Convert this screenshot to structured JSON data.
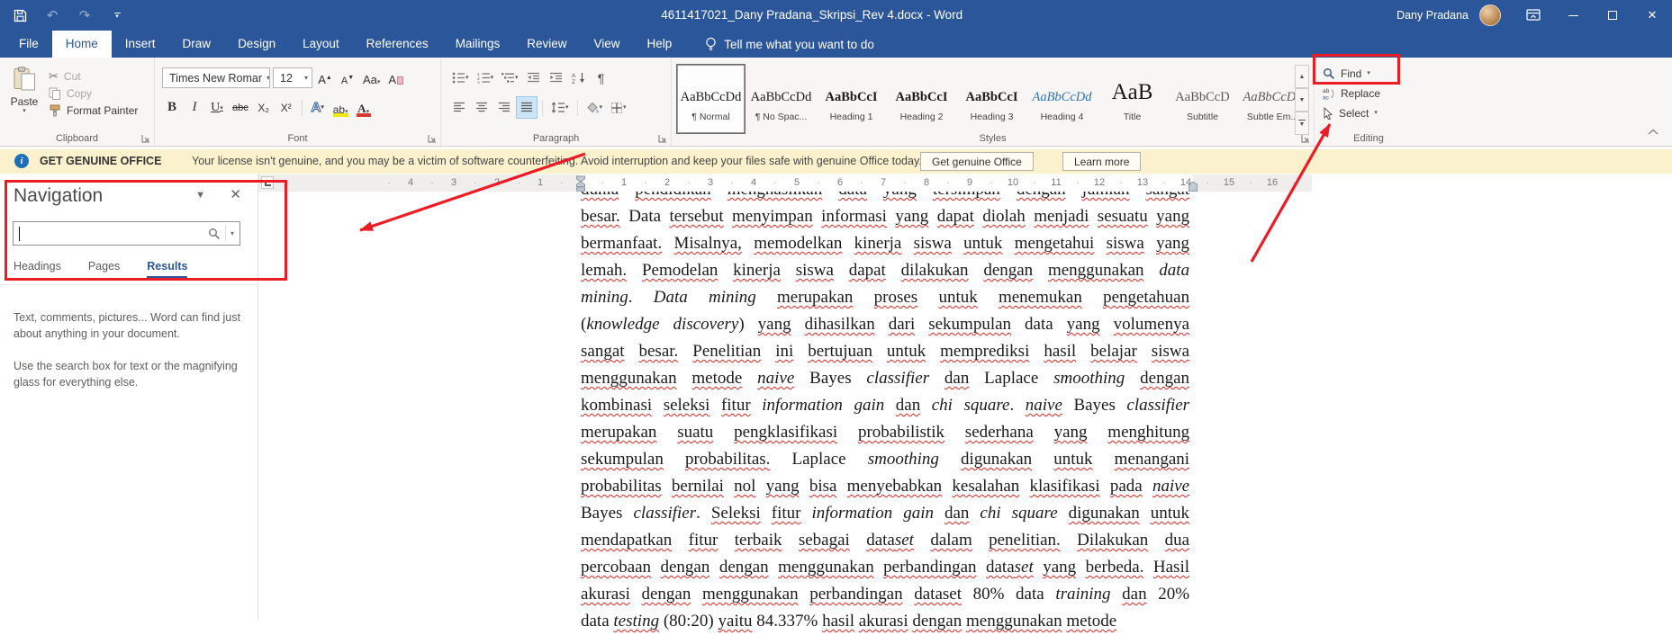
{
  "colors": {
    "accent": "#2b579a",
    "annotation": "#ec1c24",
    "warning_bg": "#fbf2cd",
    "squiggle": "#e0241b"
  },
  "titlebar": {
    "title": "4611417021_Dany Pradana_Skripsi_Rev 4.docx - Word",
    "user_name": "Dany Pradana"
  },
  "menu": {
    "tabs": [
      {
        "label": "File",
        "active": false
      },
      {
        "label": "Home",
        "active": true
      },
      {
        "label": "Insert",
        "active": false
      },
      {
        "label": "Draw",
        "active": false
      },
      {
        "label": "Design",
        "active": false
      },
      {
        "label": "Layout",
        "active": false
      },
      {
        "label": "References",
        "active": false
      },
      {
        "label": "Mailings",
        "active": false
      },
      {
        "label": "Review",
        "active": false
      },
      {
        "label": "View",
        "active": false
      },
      {
        "label": "Help",
        "active": false
      }
    ],
    "tell_me": "Tell me what you want to do"
  },
  "ribbon": {
    "clipboard": {
      "label": "Clipboard",
      "paste": "Paste",
      "cut": "Cut",
      "copy": "Copy",
      "format_painter": "Format Painter"
    },
    "font": {
      "label": "Font",
      "font_name": "Times New Romar",
      "font_size": "12",
      "buttons": {
        "grow": "A",
        "shrink": "A",
        "change_case": "Aa",
        "clear": "A",
        "bold": "B",
        "italic": "I",
        "underline": "U",
        "strikethrough": "abc",
        "subscript": "X₂",
        "superscript": "X²",
        "effects": "A",
        "highlight": "ab",
        "color": "A"
      }
    },
    "paragraph": {
      "label": "Paragraph",
      "pilcrow": "¶",
      "sort_a": "A",
      "sort_z": "Z"
    },
    "styles": {
      "label": "Styles",
      "items": [
        {
          "preview": "AaBbCcDd",
          "name": "¶ Normal",
          "style": "normal",
          "selected": true
        },
        {
          "preview": "AaBbCcDd",
          "name": "¶ No Spac...",
          "style": "nospac",
          "selected": false
        },
        {
          "preview": "AaBbCcI",
          "name": "Heading 1",
          "style": "h1",
          "selected": false
        },
        {
          "preview": "AaBbCcI",
          "name": "Heading 2",
          "style": "h2",
          "selected": false
        },
        {
          "preview": "AaBbCcI",
          "name": "Heading 3",
          "style": "h3",
          "selected": false
        },
        {
          "preview": "AaBbCcDd",
          "name": "Heading 4",
          "style": "h4",
          "selected": false
        },
        {
          "preview": "AaB",
          "name": "Title",
          "style": "title",
          "selected": false
        },
        {
          "preview": "AaBbCcD",
          "name": "Subtitle",
          "style": "subtitle",
          "selected": false
        },
        {
          "preview": "AaBbCcDd",
          "name": "Subtle Em...",
          "style": "subtle",
          "selected": false
        }
      ]
    },
    "editing": {
      "label": "Editing",
      "find": "Find",
      "replace": "Replace",
      "select": "Select"
    }
  },
  "warning_bar": {
    "title": "GET GENUINE OFFICE",
    "message": "Your license isn't genuine, and you may be a victim of software counterfeiting. Avoid interruption and keep your files safe with genuine Office today.",
    "buttons": [
      "Get genuine Office",
      "Learn more"
    ]
  },
  "navigation_pane": {
    "title": "Navigation",
    "search_value": "",
    "tabs": [
      {
        "label": "Headings",
        "active": false
      },
      {
        "label": "Pages",
        "active": false
      },
      {
        "label": "Results",
        "active": true
      }
    ],
    "body_text_1": "Text, comments, pictures... Word can find just about anything in your document.",
    "body_text_2": "Use the search box for text or the magnifying glass for everything else."
  },
  "ruler": {
    "left_numbers": [
      "4",
      "3",
      "2",
      "1"
    ],
    "page_numbers": [
      "1",
      "2",
      "3",
      "4",
      "5",
      "6",
      "7",
      "8",
      "9",
      "10",
      "11",
      "12",
      "13",
      "14"
    ],
    "right_numbers": [
      "15",
      "16"
    ]
  },
  "document": {
    "lines": [
      "~dunia pendidikan menghasilkan data yang tersimpan dengan jumlah sangat~",
      "~besar.~ Data ~tersebut menyimpan informasi yang dapat diolah menjadi sesuatu yang~",
      "~bermanfaat. Misalnya, memodelkan kinerja siswa untuk mengetahui siswa yang~",
      "~lemah. Pemodelan kinerja siswa dapat dilakukan dengan menggunakan~ *data*",
      "*mining*. *Data mining* ~merupakan proses untuk menemukan pengetahuan~",
      "(*knowledge discovery*) ~yang dihasilkan dari sekumpulan~ data ~yang volumenya~",
      "~sangat besar. Penelitian ini bertujuan untuk memprediksi hasil belajar siswa~",
      "~menggunakan metode~ *~naive~* Bayes *classifier* ~dan~ Laplace *smoothing* ~dengan~",
      "~kombinasi seleksi fitur~ *information gain* ~dan~ *chi square*. *~naive~* Bayes *classifier*",
      "~merupakan suatu pengklasifikasi probabilistik sederhana yang menghitung~",
      "~sekumpulan probabilitas.~ Laplace *smoothing* ~digunakan untuk menangani~",
      "~probabilitas bernilai nol yang bisa menyebabkan kesalahan klasifikasi pada~ *~naive~*",
      "Bayes *classifier*. ~Seleksi fitur~ *information gain* ~dan~ *chi square* ~digunakan untuk~",
      "~mendapatkan fitur terbaik sebagai~ ~data*set*~ ~dalam penelitian. Dilakukan dua~",
      "~percobaan dengan dengan menggunakan perbandingan~ ~data*set*~ ~yang berbeda. Hasil~",
      "~akurasi dengan menggunakan perbandingan dataset~ 80% data *training* ~dan~ 20%",
      "data *~testing~* (80:20) ~yaitu~ 84.337% ~hasil akurasi dengan menggunakan metode~"
    ]
  }
}
